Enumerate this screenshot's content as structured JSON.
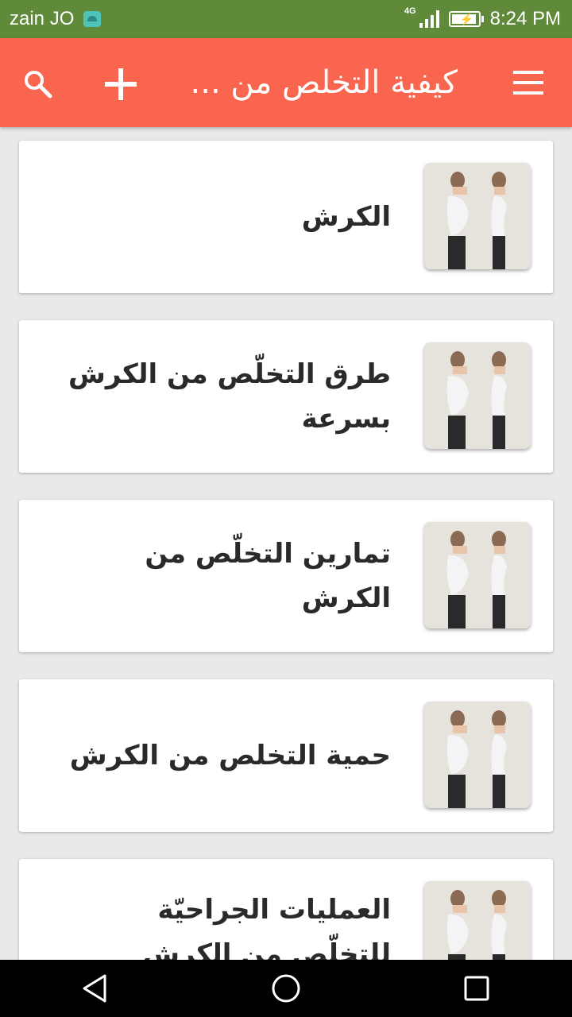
{
  "status_bar": {
    "carrier": "zain JO",
    "network": "4G",
    "time": "8:24 PM"
  },
  "app_bar": {
    "title": "كيفية التخلص من ...",
    "menu_icon": "hamburger-menu-icon",
    "add_icon": "plus-icon",
    "search_icon": "search-icon",
    "color": "#f9654e"
  },
  "articles": [
    {
      "title": "الكرش"
    },
    {
      "title": "طرق التخلّص من الكرش بسرعة"
    },
    {
      "title": "تمارين التخلّص من الكرش"
    },
    {
      "title": "حمية التخلص من الكرش"
    },
    {
      "title": "العمليات الجراحيّة للتخلّص من الكرش"
    }
  ],
  "nav_bar": {
    "back_icon": "back-triangle-icon",
    "home_icon": "home-circle-icon",
    "recents_icon": "recents-square-icon"
  }
}
